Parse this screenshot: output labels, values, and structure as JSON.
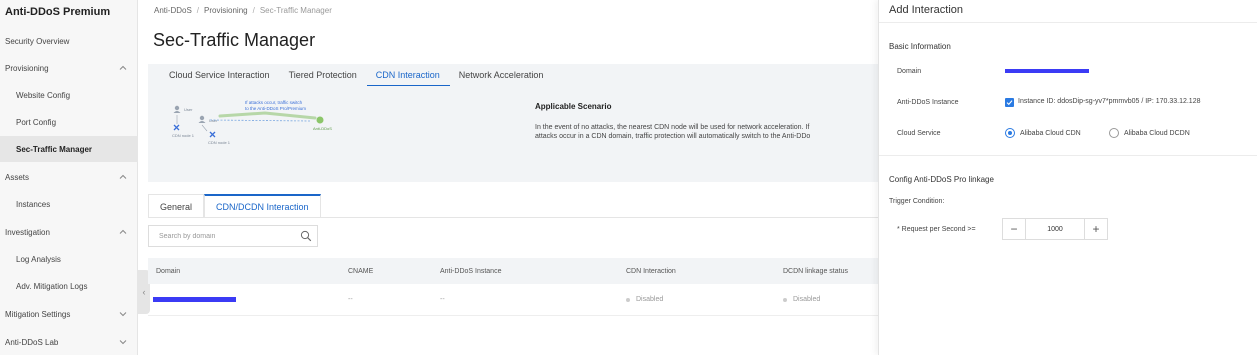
{
  "sidebar": {
    "title": "Anti-DDoS Premium",
    "items": [
      {
        "label": "Security Overview"
      },
      {
        "label": "Provisioning"
      },
      {
        "label": "Website Config"
      },
      {
        "label": "Port Config"
      },
      {
        "label": "Sec-Traffic Manager"
      },
      {
        "label": "Assets"
      },
      {
        "label": "Instances"
      },
      {
        "label": "Investigation"
      },
      {
        "label": "Log Analysis"
      },
      {
        "label": "Adv. Mitigation Logs"
      },
      {
        "label": "Mitigation Settings"
      },
      {
        "label": "Anti-DDoS Lab"
      }
    ]
  },
  "breadcrumb": [
    "Anti-DDoS",
    "Provisioning",
    "Sec-Traffic Manager"
  ],
  "page": {
    "title": "Sec-Traffic Manager"
  },
  "top_tabs": [
    "Cloud Service Interaction",
    "Tiered Protection",
    "CDN Interaction",
    "Network Acceleration"
  ],
  "diagram": {
    "user_label_1": "User",
    "user_label_2": "User",
    "note_line1": "If attacks occur, traffic switch",
    "note_line2": "to the Anti-DDoS Pro/Premium",
    "node_label_1": "CDN node 1",
    "node_label_2": "CDN node 1",
    "antiddos_label": "Anti-DDoS"
  },
  "scenario": {
    "title": "Applicable Scenario",
    "line1": "In the event of no attacks, the nearest CDN node will be used for network acceleration. If",
    "line2": "attacks occur in a CDN domain, traffic protection will automatically switch to the Anti-DDo"
  },
  "bottom_tabs": [
    "General",
    "CDN/DCDN Interaction"
  ],
  "search": {
    "placeholder": "Search by domain"
  },
  "table": {
    "columns": [
      "Domain",
      "CNAME",
      "Anti-DDoS Instance",
      "CDN Interaction",
      "DCDN linkage status"
    ],
    "rows": [
      {
        "cname": "--",
        "instance": "--",
        "cdn": "Disabled",
        "dcdn": "Disabled"
      }
    ]
  },
  "drawer": {
    "title": "Add Interaction",
    "basic_info": "Basic Information",
    "domain_label": "Domain",
    "instance_label": "Anti-DDoS Instance",
    "instance_value": "Instance ID: ddosDip-sg-yv7*pmmvb05 / IP: 170.33.12.128",
    "cloud_label": "Cloud Service",
    "cloud_options": [
      "Alibaba Cloud CDN",
      "Alibaba Cloud DCDN"
    ],
    "config_title": "Config Anti-DDoS Pro linkage",
    "trigger_label": "Trigger Condition:",
    "rps_label": "* Request per Second >=",
    "rps_value": "1000",
    "minus": "−",
    "plus": "+"
  },
  "colors": {
    "accent": "#1a66c9",
    "redaction": "#3b3bf5"
  }
}
